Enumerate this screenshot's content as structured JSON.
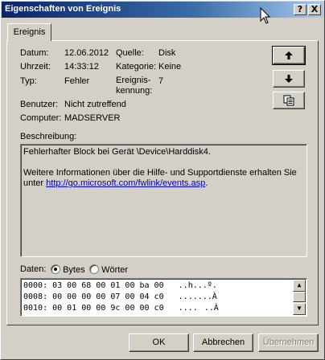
{
  "window": {
    "title": "Eigenschaften von Ereignis"
  },
  "titlebar_buttons": {
    "help": "?",
    "close": "X"
  },
  "tab": {
    "label": "Ereignis"
  },
  "fields": {
    "datum_label": "Datum:",
    "datum_value": "12.06.2012",
    "uhrzeit_label": "Uhrzeit:",
    "uhrzeit_value": "14:33:12",
    "typ_label": "Typ:",
    "typ_value": "Fehler",
    "benutzer_label": "Benutzer:",
    "benutzer_value": "Nicht zutreffend",
    "computer_label": "Computer:",
    "computer_value": "MADSERVER",
    "quelle_label": "Quelle:",
    "quelle_value": "Disk",
    "kategorie_label": "Kategorie:",
    "kategorie_value": "Keine",
    "kennung_label_1": "Ereignis-",
    "kennung_label_2": "kennung:",
    "kennung_value": "7"
  },
  "description": {
    "label": "Beschreibung:",
    "line1": "Fehlerhafter Block bei Gerät \\Device\\Harddisk4.",
    "line2": "Weitere Informationen über die Hilfe- und Supportdienste erhalten Sie",
    "line3_prefix": "unter ",
    "link": "http://go.microsoft.com/fwlink/events.asp",
    "line3_suffix": "."
  },
  "data": {
    "label": "Daten:",
    "option_bytes": "Bytes",
    "option_words": "Wörter",
    "selected": "Bytes",
    "rows": [
      "0000: 03 00 68 00 01 00 ba 00   ..h...º.",
      "0008: 00 00 00 00 07 00 04 c0   .......À",
      "0010: 00 01 00 00 9c 00 00 c0   ......À"
    ]
  },
  "buttons": {
    "ok": "OK",
    "cancel": "Abbrechen",
    "apply": "Übernehmen"
  }
}
